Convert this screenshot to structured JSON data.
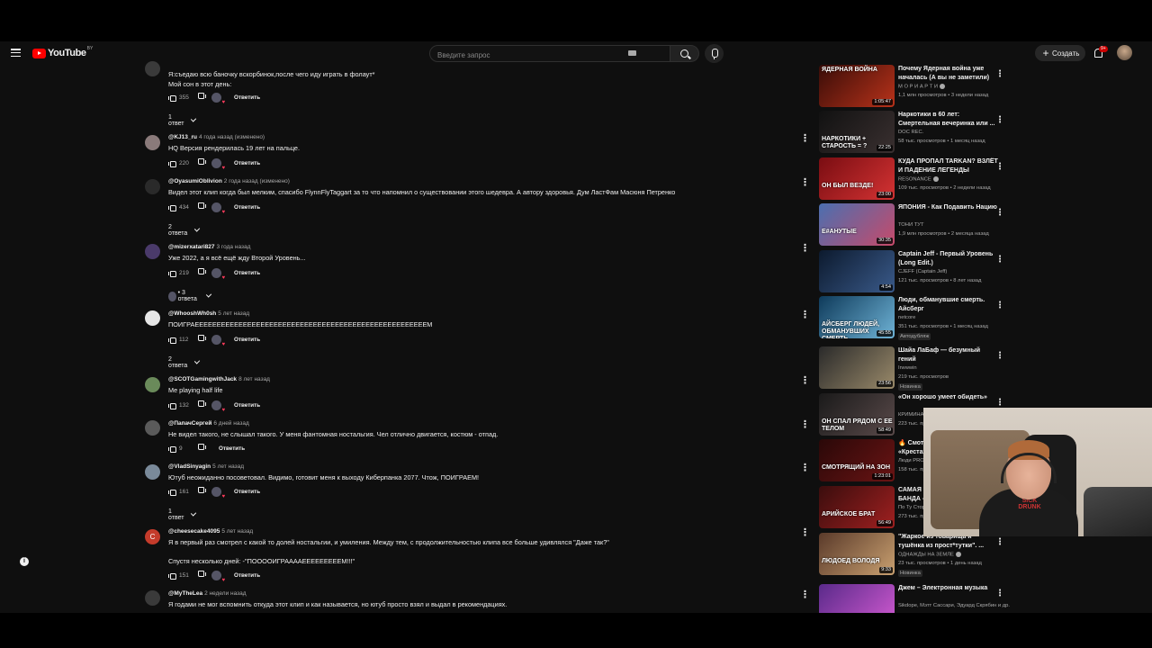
{
  "header": {
    "logo_text": "YouTube",
    "logo_country": "BY",
    "search_placeholder": "Введите запрос",
    "create_label": "Создать",
    "notifications_badge": "9+"
  },
  "comments": [
    {
      "author": "",
      "time": "",
      "text_lines": [
        "Я:съедаю всю баночку вскорбинок,после чего иду играть в фолаут*",
        "Мой сон в этот день:"
      ],
      "likes": "355",
      "reply_label": "Ответить",
      "replies_label": "1 ответ"
    },
    {
      "author": "@KJ13_ru",
      "time": "4 года назад (изменено)",
      "text_lines": [
        "HQ Версия рендерилась 19 лет на пальце."
      ],
      "likes": "220",
      "reply_label": "Ответить",
      "replies_label": ""
    },
    {
      "author": "@OyasumiOblivion",
      "time": "2 года назад (изменено)",
      "text_lines": [
        "Видел этот клип когда был мелким, спасибо FlynnFlyTaggart за то что напомнил о существовании этого шедевра. А автору здоровья. Дум ЛастФам Масюня Петренко"
      ],
      "likes": "434",
      "reply_label": "Ответить",
      "replies_label": "2 ответа"
    },
    {
      "author": "@mizerxatari827",
      "time": "3 года назад",
      "text_lines": [
        "Уже 2022, а я всё ещё жду Второй Уровень..."
      ],
      "likes": "219",
      "reply_label": "Ответить",
      "replies_label": "• 3 ответа"
    },
    {
      "author": "@WhooshWh0sh",
      "time": "5 лет назад",
      "text_lines": [
        "ПОИГРАЕЕЕЕЕЕЕЕЕЕЕЕЕЕЕЕЕЕЕЕЕЕЕЕЕЕЕЕЕЕЕЕЕЕЕЕЕЕЕЕЕЕЕЕЕЕЕЕЕЕЕЕЕМ"
      ],
      "likes": "112",
      "reply_label": "Ответить",
      "replies_label": "2 ответа"
    },
    {
      "author": "@SCOTGamingwithJack",
      "time": "8 лет назад",
      "text_lines": [
        "Me playing half life"
      ],
      "likes": "132",
      "reply_label": "Ответить",
      "replies_label": ""
    },
    {
      "author": "@ПапачСергей",
      "time": "6 дней назад",
      "text_lines": [
        "Не видел такого, не слышал такого. У меня фантомная ностальгия. Чел отлично двигается, костюм - отпад."
      ],
      "likes": "9",
      "reply_label": "Ответить",
      "replies_label": ""
    },
    {
      "author": "@VladSinyagin",
      "time": "5 лет назад",
      "text_lines": [
        "Ютуб неожиданно посоветовал. Видимо, готовит меня к выходу Киберпанка 2077. Чтож, ПОИГРАЕМ!"
      ],
      "likes": "161",
      "reply_label": "Ответить",
      "replies_label": "1 ответ"
    },
    {
      "author": "@cheesecake4095",
      "time": "5 лет назад",
      "text_lines": [
        "Я в первый раз смотрел с какой то долей ностальгии, и умиления. Между тем, с продолжительностью клипа все больше удивлялся \"Даже так?\"",
        "",
        "Спустя несколько дней: -\"ПООООИГРААААЕЕЕЕЕЕЕЕЕМ!!!\""
      ],
      "likes": "151",
      "reply_label": "Ответить",
      "replies_label": ""
    },
    {
      "author": "@MyTheLea",
      "time": "2 недели назад",
      "text_lines": [
        "Я годами не мог вспомнить откуда этот клип и как называется, но ютуб просто взял и выдал в рекомендациях."
      ],
      "likes": "",
      "reply_label": "",
      "replies_label": ""
    }
  ],
  "recommendations": [
    {
      "title": "Почему Ядерная война уже началась (А вы не заметили)",
      "channel": "М О Р И А Р Т И",
      "stats": "1,1 млн просмотров • 3 недели назад",
      "duration": "1:05:47",
      "thumb_text": "ЯДЕРНАЯ ВОЙНА",
      "badge": "",
      "colors": [
        "#3a0d08",
        "#b8321a"
      ]
    },
    {
      "title": "Наркотики в 60 лет: Смертельная вечеринка или ...",
      "channel": "DOC REC.",
      "stats": "58 тыс. просмотров • 1 месяц назад",
      "duration": "22:25",
      "thumb_text": "НАРКОТИКИ + СТАРОСТЬ = ?",
      "badge": "",
      "colors": [
        "#111",
        "#3a3030"
      ]
    },
    {
      "title": "КУДА ПРОПАЛ TARKAN? ВЗЛЁТ И ПАДЕНИЕ ЛЕГЕНДЫ",
      "channel": "RESONANCE",
      "stats": "109 тыс. просмотров • 2 недели назад",
      "duration": "23:00",
      "thumb_text": "ОН БЫЛ ВЕЗДЕ!",
      "badge": "",
      "colors": [
        "#7a0d12",
        "#d43333"
      ]
    },
    {
      "title": "ЯПОНИЯ - Как Подавить Нацию",
      "channel": "ТОНИ ТУТ",
      "stats": "1,9 млн просмотров • 2 месяца назад",
      "duration": "30:35",
      "thumb_text": "Е#АНУТЫЕ",
      "badge": "",
      "colors": [
        "#4a6fb0",
        "#c74a6a"
      ]
    },
    {
      "title": "Captain Jeff - Первый Уровень (Long Edit.)",
      "channel": "CJEFF (Captain Jeff)",
      "stats": "121 тыс. просмотров • 8 лет назад",
      "duration": "4:54",
      "thumb_text": "",
      "badge": "",
      "colors": [
        "#0c1a2e",
        "#3a5a8a"
      ]
    },
    {
      "title": "Люди, обманувшие смерть. Айсберг",
      "channel": "netcore",
      "stats": "351 тыс. просмотров • 1 месяц назад",
      "duration": "45:55",
      "thumb_text": "АЙСБЕРГ ЛЮДЕЙ, ОБМАНУВШИХ СМЕРТЬ",
      "badge": "Автодубляж",
      "colors": [
        "#0e3a5a",
        "#6fb3d6"
      ]
    },
    {
      "title": "Шайа ЛаБаф — безумный гений",
      "channel": "Irwwwin",
      "stats": "219 тыс. просмотров",
      "duration": "23:56",
      "thumb_text": "",
      "badge": "Новинка",
      "colors": [
        "#2a2a2a",
        "#9a8a6a"
      ]
    },
    {
      "title": "«Он хорошо умеет обидеть»",
      "channel": "КРИМИНАЛ",
      "stats": "223 тыс. просмотров",
      "duration": "58:49",
      "thumb_text": "ОН СПАЛ РЯДОМ С ЕЕ ТЕЛОМ",
      "badge": "",
      "colors": [
        "#1a1a1a",
        "#5a4a4a"
      ]
    },
    {
      "title": "🔥 Смотрящий на зоне «Крестах»",
      "channel": "Люди PRO",
      "stats": "158 тыс. просмотров",
      "duration": "1:23:01",
      "thumb_text": "СМОТРЯЩИЙ НА ЗОН",
      "badge": "",
      "colors": [
        "#2a0808",
        "#6a1414"
      ]
    },
    {
      "title": "САМАЯ ЗВЕРСКАЯ ТЮРЕМНАЯ БАНДА - ...",
      "channel": "По Ту Сторону Закона",
      "stats": "273 тыс. просмотров • 1 месяц назад",
      "duration": "56:49",
      "thumb_text": "АРИЙСКОЕ БРАТ",
      "badge": "",
      "colors": [
        "#3a0d0d",
        "#a02020"
      ]
    },
    {
      "title": "\"Жаркое из товарища и тушёнка из прост*тутки\". ...",
      "channel": "ОДНАЖДЫ НА ЗЕМЛЕ",
      "stats": "23 тыс. просмотров • 1 день назад",
      "duration": "9:33",
      "thumb_text": "ЛЮДОЕД ВОЛОДЯ",
      "badge": "Новинка",
      "colors": [
        "#5a3a2a",
        "#c9a070"
      ]
    },
    {
      "title": "Джем – Электронная музыка",
      "channel": "Sikdope, Мэтт Сассари, Эдуард Скрябин и др.",
      "stats": "",
      "duration": "",
      "thumb_text": "",
      "badge": "",
      "colors": [
        "#5a2a8a",
        "#d05ad0"
      ]
    }
  ],
  "webcam": {
    "shirt_print": "SICK DRUNK"
  }
}
